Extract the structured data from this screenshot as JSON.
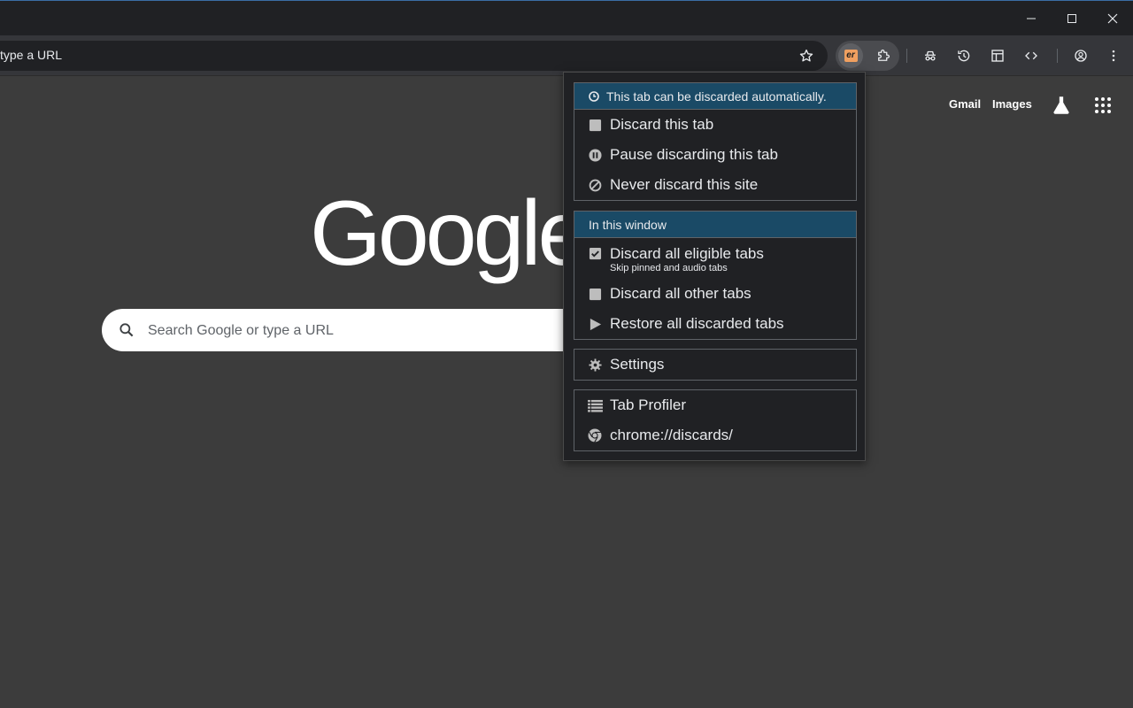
{
  "browser": {
    "omnibox_text": "type a URL",
    "window_controls": [
      "minimize-icon",
      "maximize-icon",
      "close-icon"
    ],
    "toolbar_icons": [
      "star-icon",
      "extension-er-icon",
      "puzzle-icon",
      "incognito-icon",
      "history-icon",
      "tab-search-icon",
      "devtools-icon",
      "profile-icon",
      "menu-dots-icon"
    ],
    "ext_badge": "er",
    "accent_color": "#f0a060"
  },
  "google": {
    "logo": "Google",
    "links": {
      "gmail": "Gmail",
      "images": "Images"
    },
    "search_placeholder": "Search Google or type a URL"
  },
  "popup": {
    "status": "This tab can be discarded automatically.",
    "tab_actions": [
      {
        "label": "Discard this tab",
        "icon": "square-icon"
      },
      {
        "label": "Pause discarding this tab",
        "icon": "pause-circle-icon"
      },
      {
        "label": "Never discard this site",
        "icon": "ban-icon"
      }
    ],
    "window_header": "In this window",
    "window_actions": [
      {
        "label": "Discard all eligible tabs",
        "sub": "Skip pinned and audio tabs",
        "icon": "checkbox-checked-icon"
      },
      {
        "label": "Discard all other tabs",
        "icon": "square-icon"
      },
      {
        "label": "Restore all discarded tabs",
        "icon": "play-icon"
      }
    ],
    "settings": "Settings",
    "tools": [
      {
        "label": "Tab Profiler",
        "icon": "list-icon"
      },
      {
        "label": "chrome://discards/",
        "icon": "chrome-icon"
      }
    ],
    "header_color": "#1a4a66"
  }
}
